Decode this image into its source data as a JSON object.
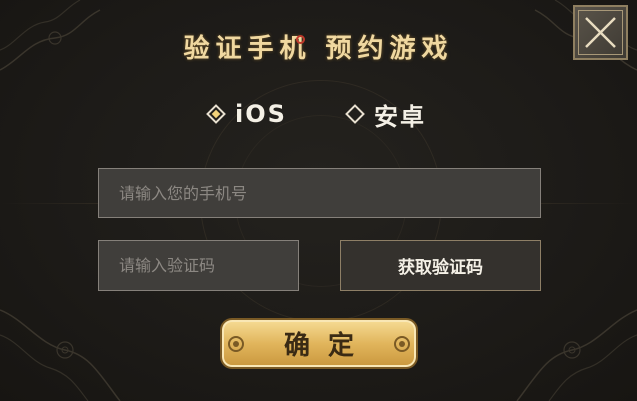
{
  "dialog": {
    "title_part1": "验证手机",
    "title_part2": "预约游戏",
    "close_icon": "close-x-icon"
  },
  "platform": {
    "selected": "iOS",
    "options": [
      {
        "label": "iOS",
        "icon": "diamond-radio-checked-icon"
      },
      {
        "label": "安卓",
        "icon": "diamond-radio-unchecked-icon"
      }
    ]
  },
  "form": {
    "phone": {
      "value": "",
      "placeholder": "请输入您的手机号"
    },
    "code": {
      "value": "",
      "placeholder": "请输入验证码"
    },
    "get_code_label": "获取验证码",
    "confirm_label": "确定"
  },
  "colors": {
    "background": "#1d1b18",
    "title_gold": "#f0d8a0",
    "input_bg": "#403e3b",
    "confirm_gold": "#e1b55c"
  }
}
